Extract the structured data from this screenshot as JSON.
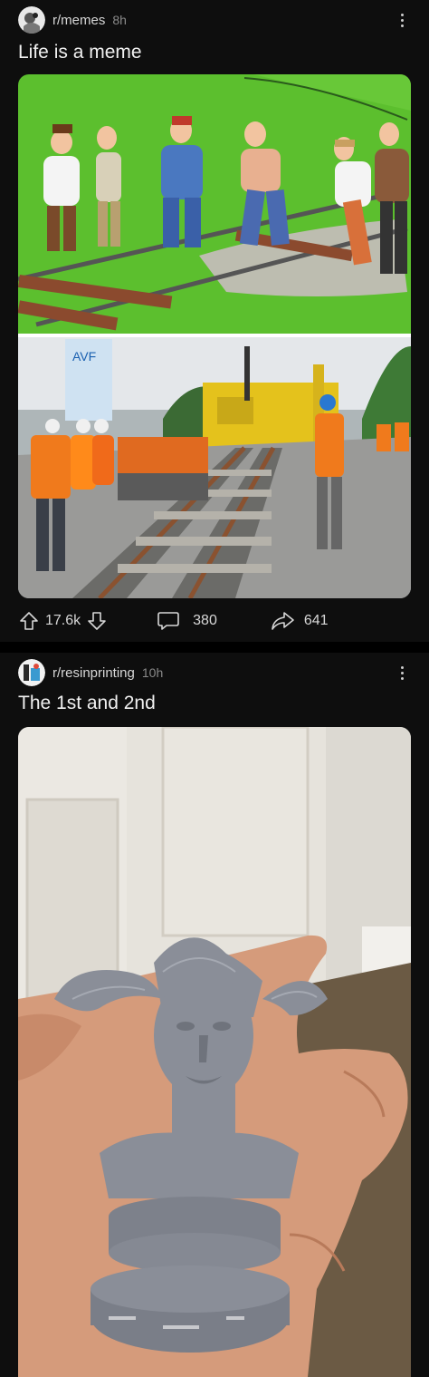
{
  "posts": [
    {
      "subreddit": "r/memes",
      "time": "8h",
      "title": "Life is a meme",
      "upvotes": "17.6k",
      "comments": "380",
      "shares": "641",
      "image_top_description": "cartoon of workers watching one man on railway track",
      "image_bottom_description": "photo of many workers in orange vests watching track machine"
    },
    {
      "subreddit": "r/resinprinting",
      "time": "10h",
      "title": "The 1st and 2nd"
    }
  ],
  "colors": {
    "background": "#0e0e0e",
    "text": "#f0f0f0",
    "muted": "#8a8a8a"
  }
}
